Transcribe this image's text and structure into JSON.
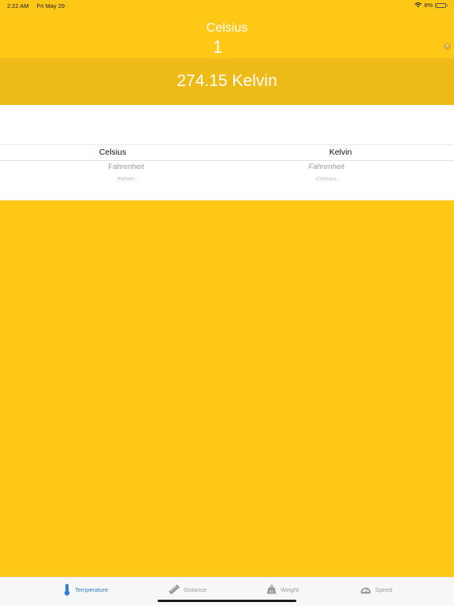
{
  "status_bar": {
    "time": "2:22 AM",
    "date": "Fri May 29",
    "battery": "8%",
    "battery_level": 0.08
  },
  "header": {
    "from_unit": "Celsius",
    "input_value": "1"
  },
  "result": {
    "text": "274.15 Kelvin"
  },
  "picker": {
    "left": {
      "selected": "Celsius",
      "next": "Fahrenheit",
      "next2": "Kelvin"
    },
    "right": {
      "selected": "Kelvin",
      "next": "Fahrenheit",
      "next2": "Celsius"
    }
  },
  "tab_bar": {
    "items": [
      {
        "label": "Temperature",
        "icon": "thermometer-icon",
        "active": true
      },
      {
        "label": "Distance",
        "icon": "ruler-icon",
        "active": false
      },
      {
        "label": "Weight",
        "icon": "weight-icon",
        "active": false
      },
      {
        "label": "Speed",
        "icon": "speedometer-icon",
        "active": false
      }
    ]
  },
  "colors": {
    "background": "#FFC716",
    "result_band": "#EDBA17",
    "accent": "#2F7FD6"
  }
}
